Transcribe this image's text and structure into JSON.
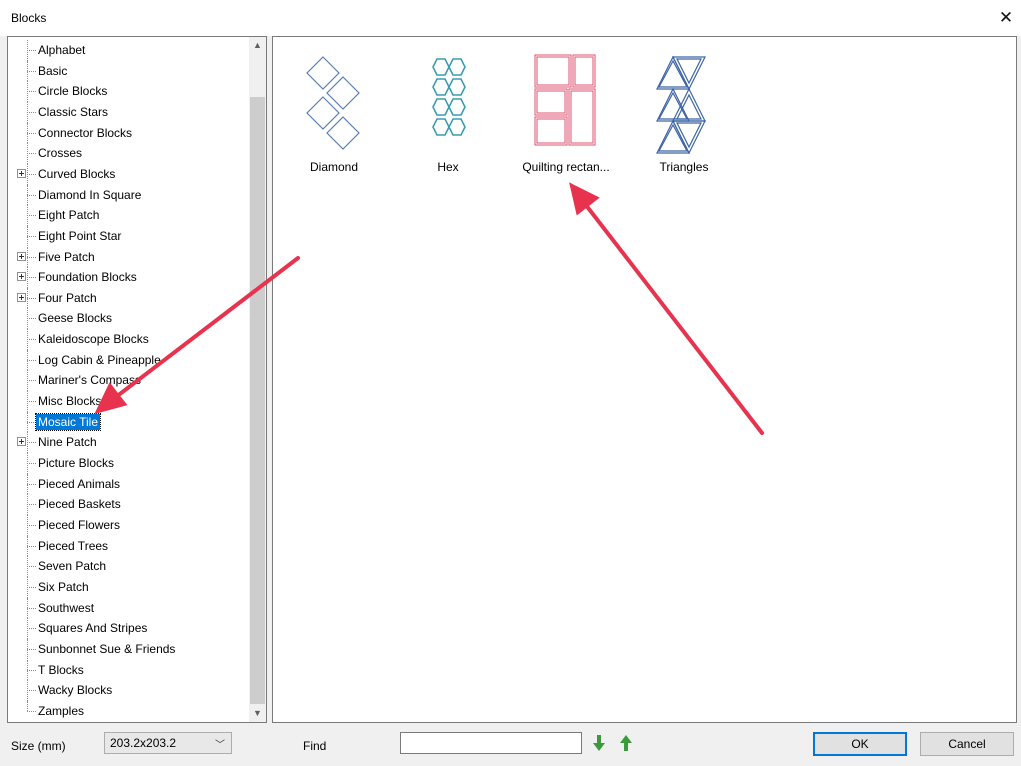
{
  "window": {
    "title": "Blocks",
    "close_glyph": "✕"
  },
  "tree": {
    "selected_index": 18,
    "items": [
      {
        "label": "Alphabet",
        "expandable": false
      },
      {
        "label": "Basic",
        "expandable": false
      },
      {
        "label": "Circle Blocks",
        "expandable": false
      },
      {
        "label": "Classic Stars",
        "expandable": false
      },
      {
        "label": "Connector Blocks",
        "expandable": false
      },
      {
        "label": "Crosses",
        "expandable": false
      },
      {
        "label": "Curved Blocks",
        "expandable": true
      },
      {
        "label": "Diamond In Square",
        "expandable": false
      },
      {
        "label": "Eight Patch",
        "expandable": false
      },
      {
        "label": "Eight Point Star",
        "expandable": false
      },
      {
        "label": "Five Patch",
        "expandable": true
      },
      {
        "label": "Foundation Blocks",
        "expandable": true
      },
      {
        "label": "Four Patch",
        "expandable": true
      },
      {
        "label": "Geese Blocks",
        "expandable": false
      },
      {
        "label": "Kaleidoscope Blocks",
        "expandable": false
      },
      {
        "label": "Log Cabin & Pineapple",
        "expandable": false
      },
      {
        "label": "Mariner's Compass",
        "expandable": false
      },
      {
        "label": "Misc Blocks",
        "expandable": false
      },
      {
        "label": "Mosaic Tile",
        "expandable": false
      },
      {
        "label": "Nine Patch",
        "expandable": true
      },
      {
        "label": "Picture Blocks",
        "expandable": false
      },
      {
        "label": "Pieced Animals",
        "expandable": false
      },
      {
        "label": "Pieced Baskets",
        "expandable": false
      },
      {
        "label": "Pieced Flowers",
        "expandable": false
      },
      {
        "label": "Pieced Trees",
        "expandable": false
      },
      {
        "label": "Seven Patch",
        "expandable": false
      },
      {
        "label": "Six Patch",
        "expandable": false
      },
      {
        "label": "Southwest",
        "expandable": false
      },
      {
        "label": "Squares And Stripes",
        "expandable": false
      },
      {
        "label": "Sunbonnet Sue & Friends",
        "expandable": false
      },
      {
        "label": "T Blocks",
        "expandable": false
      },
      {
        "label": "Wacky Blocks",
        "expandable": false
      },
      {
        "label": "Zamples",
        "expandable": false
      }
    ]
  },
  "blocks": [
    {
      "label": "Diamond",
      "icon": "diamond-block-icon",
      "color": "#5a7fb5"
    },
    {
      "label": "Hex",
      "icon": "hex-block-icon",
      "color": "#3a9db0"
    },
    {
      "label": "Quilting rectan...",
      "icon": "rectangle-block-icon",
      "color": "#e0607e"
    },
    {
      "label": "Triangles",
      "icon": "triangles-block-icon",
      "color": "#3c64a8"
    }
  ],
  "bottom": {
    "size_label": "Size (mm)",
    "size_value": "203.2x203.2",
    "find_label": "Find",
    "find_value": "",
    "ok_label": "OK",
    "cancel_label": "Cancel"
  },
  "colors": {
    "selection": "#0078d7",
    "annotation_arrow": "#e8334f",
    "find_arrow": "#3c9a3c"
  }
}
